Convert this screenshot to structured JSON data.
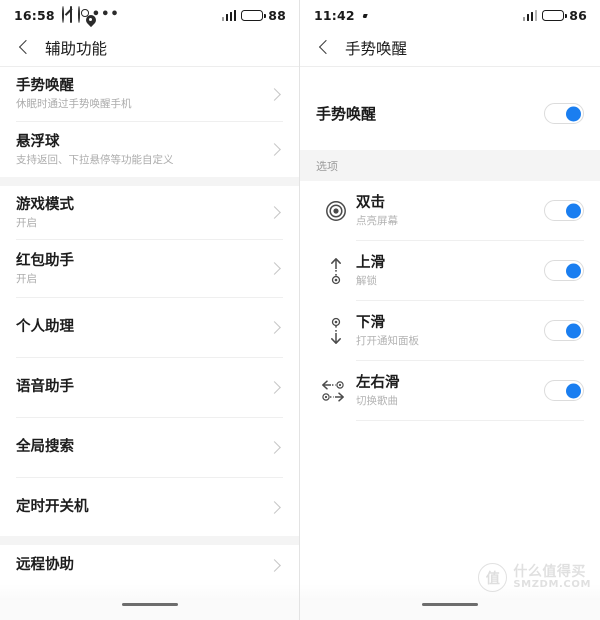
{
  "left_phone": {
    "statusbar": {
      "time": "16:58",
      "icons": [
        "mute-icon",
        "card-icon",
        "ring-icon",
        "location-pin-icon",
        "more-dots-icon"
      ],
      "signal_icon": "signal-bars-icon",
      "battery_icon": "battery-icon",
      "battery_level": "88",
      "battery_color": "#1ec81e"
    },
    "nav": {
      "back_icon": "back-chevron-icon",
      "title": "辅助功能"
    },
    "items": [
      {
        "title": "手势唤醒",
        "sub": "休眠时通过手势唤醒手机",
        "gap_after": false
      },
      {
        "title": "悬浮球",
        "sub": "支持返回、下拉悬停等功能自定义",
        "gap_after": true
      },
      {
        "title": "游戏模式",
        "sub": "开启",
        "gap_after": false
      },
      {
        "title": "红包助手",
        "sub": "开启",
        "gap_after": false
      },
      {
        "title": "个人助理",
        "sub": "",
        "gap_after": false
      },
      {
        "title": "语音助手",
        "sub": "",
        "gap_after": false
      },
      {
        "title": "全局搜索",
        "sub": "",
        "gap_after": false
      },
      {
        "title": "定时开关机",
        "sub": "",
        "gap_after": true
      },
      {
        "title": "远程协助",
        "sub": "",
        "gap_after": false
      }
    ]
  },
  "right_phone": {
    "statusbar": {
      "time": "11:42",
      "icons": [
        "chat-bubble-icon",
        "square-icon"
      ],
      "signal_icon": "signal-bars-icon",
      "battery_icon": "battery-icon",
      "battery_level": "86",
      "battery_color": "#1b1b1b"
    },
    "nav": {
      "back_icon": "back-chevron-icon",
      "title": "手势唤醒"
    },
    "master": {
      "title": "手势唤醒",
      "toggle_on": true
    },
    "section_label": "选项",
    "gestures": [
      {
        "title": "双击",
        "sub": "点亮屏幕",
        "icon": "double-tap-icon",
        "toggle_on": true
      },
      {
        "title": "上滑",
        "sub": "解锁",
        "icon": "swipe-up-icon",
        "toggle_on": true
      },
      {
        "title": "下滑",
        "sub": "打开通知面板",
        "icon": "swipe-down-icon",
        "toggle_on": true
      },
      {
        "title": "左右滑",
        "sub": "切换歌曲",
        "icon": "swipe-lr-icon",
        "toggle_on": true
      }
    ],
    "accent_color": "#1a7ef0"
  },
  "watermark": {
    "logo_char": "值",
    "cn": "什么值得买",
    "en": "SMZDM.COM"
  }
}
